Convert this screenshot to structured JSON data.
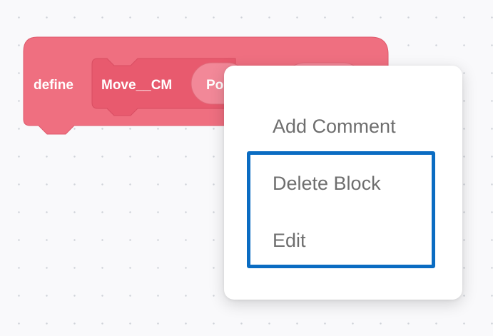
{
  "block": {
    "define_label": "define",
    "name_label": "Move__CM",
    "param_label": "Po",
    "color": "#ef6f80",
    "inner_color": "#e85a6e"
  },
  "context_menu": {
    "items": [
      {
        "label": "Add Comment"
      },
      {
        "label": "Delete Block"
      },
      {
        "label": "Edit"
      }
    ]
  },
  "highlight": {
    "color": "#0a6cc2"
  }
}
